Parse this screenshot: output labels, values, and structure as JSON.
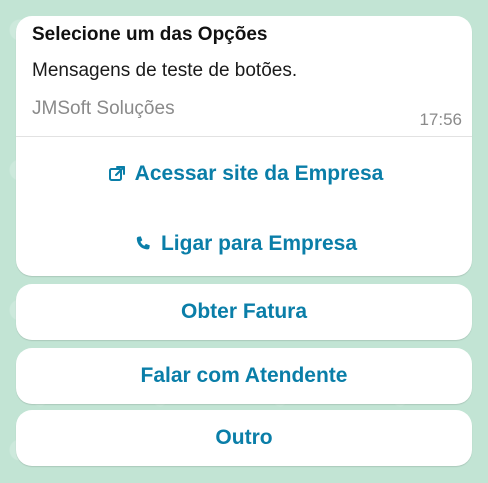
{
  "message": {
    "title": "Selecione um das Opções",
    "body": "Mensagens de teste de botões.",
    "footer": "JMSoft Soluções",
    "time": "17:56"
  },
  "card_actions": [
    {
      "icon": "external-link-icon",
      "label": "Acessar site da Empresa"
    },
    {
      "icon": "phone-icon",
      "label": "Ligar para Empresa"
    }
  ],
  "reply_buttons": [
    {
      "label": "Obter Fatura"
    },
    {
      "label": "Falar com Atendente"
    },
    {
      "label": "Outro"
    }
  ],
  "colors": {
    "background": "#c2e4d4",
    "card": "#ffffff",
    "accent": "#0a7ea8",
    "text": "#111111",
    "muted": "#8a8a8a"
  }
}
